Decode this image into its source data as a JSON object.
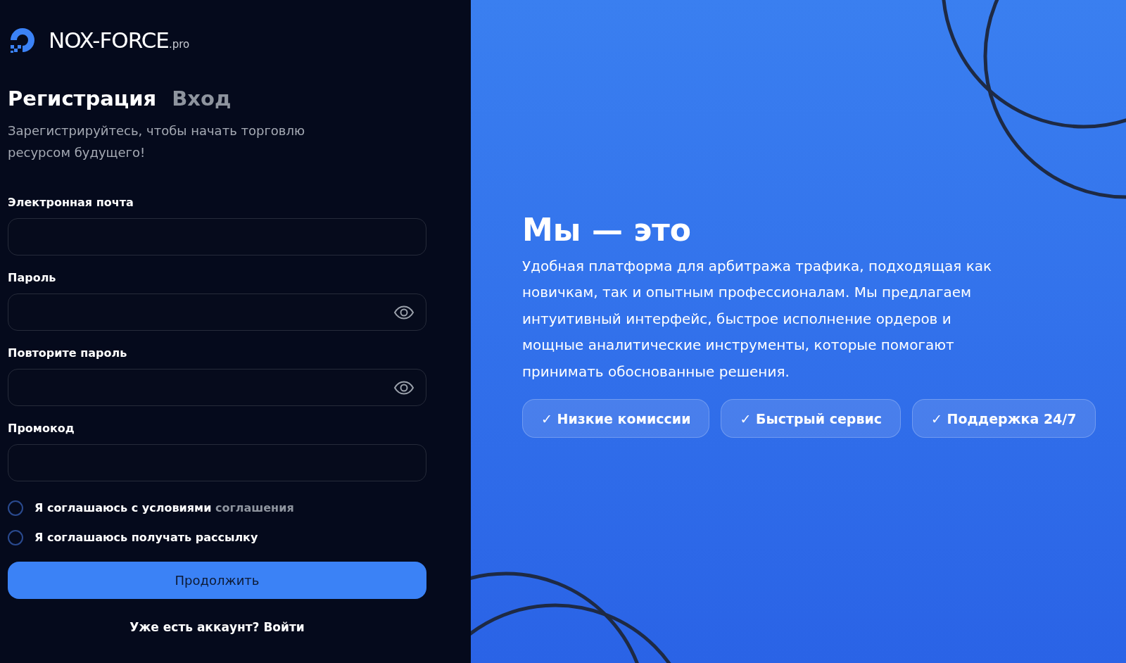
{
  "brand": {
    "name": "NOX-FORCE",
    "suffix": ".pro"
  },
  "tabs": [
    {
      "label": "Регистрация",
      "selected": true
    },
    {
      "label": "Вход",
      "selected": false
    }
  ],
  "subtitle": "Зарегистрируйтесь, чтобы начать торговлю ресурсом будущего!",
  "fields": [
    {
      "label": "Электронная почта",
      "kind": "text"
    },
    {
      "label": "Пароль",
      "kind": "password"
    },
    {
      "label": "Повторите пароль",
      "kind": "password"
    },
    {
      "label": "Промокод",
      "kind": "text"
    }
  ],
  "agreements": [
    {
      "text": "Я соглашаюсь с условиями",
      "link": "соглашения",
      "checked": false
    },
    {
      "text": "Я соглашаюсь получать рассылку",
      "checked": false
    }
  ],
  "submit": "Продолжить",
  "login_prompt": "Уже есть аккаунт? Войти",
  "promo": {
    "heading": "Мы — это",
    "text": "Удобная платформа для арбитража трафика, подходящая как новичкам, так и опытным профессионалам. Мы предлагаем интуитивный интерфейс, быстрое исполнение ордеров и мощные аналитические инструменты, которые помогают принимать обоснованные решения.",
    "features": [
      "✓ Низкие комиссии",
      "✓ Быстрый сервис",
      "✓ Поддержка 24/7"
    ]
  }
}
